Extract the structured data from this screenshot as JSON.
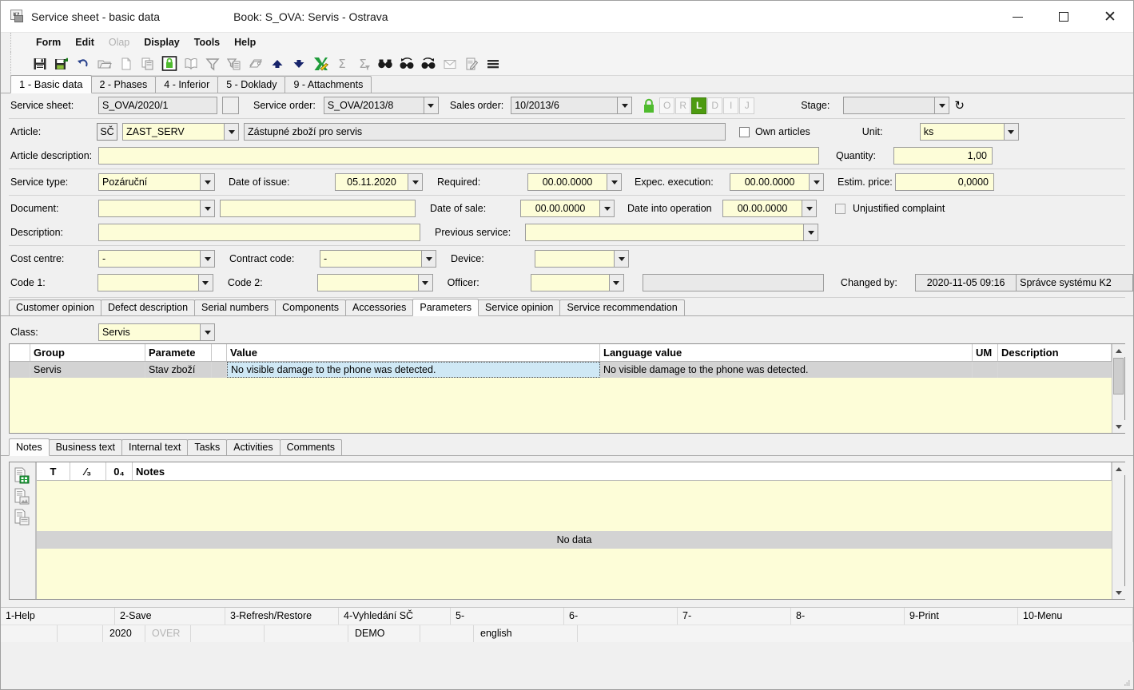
{
  "window": {
    "title": "Service sheet - basic data",
    "book": "Book: S_OVA: Servis - Ostrava",
    "minimize": "—",
    "maximize": "☐",
    "close": "✕"
  },
  "menu": {
    "items": [
      {
        "label": "Form",
        "disabled": false
      },
      {
        "label": "Edit",
        "disabled": false
      },
      {
        "label": "Olap",
        "disabled": true
      },
      {
        "label": "Display",
        "disabled": false
      },
      {
        "label": "Tools",
        "disabled": false
      },
      {
        "label": "Help",
        "disabled": false
      }
    ]
  },
  "toolbar": {
    "buttons": [
      {
        "name": "save-icon"
      },
      {
        "name": "save-and-close-icon"
      },
      {
        "name": "undo-icon"
      },
      {
        "name": "open-folder-icon"
      },
      {
        "name": "new-document-icon"
      },
      {
        "name": "copy-icon"
      },
      {
        "name": "lock-icon"
      },
      {
        "name": "book-icon"
      },
      {
        "name": "filter-icon"
      },
      {
        "name": "filter-document-icon"
      },
      {
        "name": "print-icon"
      },
      {
        "name": "move-up-icon"
      },
      {
        "name": "move-down-icon"
      },
      {
        "name": "export-excel-icon"
      },
      {
        "name": "sum-icon"
      },
      {
        "name": "sum-filter-icon"
      },
      {
        "name": "find-icon"
      },
      {
        "name": "find-previous-icon"
      },
      {
        "name": "find-next-icon"
      },
      {
        "name": "mail-icon"
      },
      {
        "name": "edit-note-icon"
      },
      {
        "name": "menu-icon"
      }
    ]
  },
  "main_tabs": [
    {
      "label": "1 - Basic data",
      "active": true
    },
    {
      "label": "2 - Phases",
      "active": false
    },
    {
      "label": "4 - Inferior",
      "active": false
    },
    {
      "label": "5 - Doklady",
      "active": false
    },
    {
      "label": "9 - Attachments",
      "active": false
    }
  ],
  "form": {
    "service_sheet_label": "Service sheet:",
    "service_sheet_value": "S_OVA/2020/1",
    "service_order_label": "Service order:",
    "service_order_value": "S_OVA/2013/8",
    "sales_order_label": "Sales order:",
    "sales_order_value": "10/2013/6",
    "status_letters": [
      {
        "letter": "O",
        "active": false
      },
      {
        "letter": "R",
        "active": false
      },
      {
        "letter": "L",
        "active": true
      },
      {
        "letter": "D",
        "active": false
      },
      {
        "letter": "I",
        "active": false
      },
      {
        "letter": "J",
        "active": false
      }
    ],
    "stage_label": "Stage:",
    "stage_value": "",
    "article_label": "Article:",
    "article_button": "SČ",
    "article_code": "ZAST_SERV",
    "article_name": "Zástupné zboží pro servis",
    "own_articles_label": "Own articles",
    "own_articles_checked": false,
    "unit_label": "Unit:",
    "unit_value": "ks",
    "article_description_label": "Article description:",
    "article_description_value": "",
    "quantity_label": "Quantity:",
    "quantity_value": "1,00",
    "service_type_label": "Service type:",
    "service_type_value": "Pozáruční",
    "date_of_issue_label": "Date of issue:",
    "date_of_issue_value": "05.11.2020",
    "required_label": "Required:",
    "required_value": "00.00.0000",
    "expec_execution_label": "Expec. execution:",
    "expec_execution_value": "00.00.0000",
    "estim_price_label": "Estim. price:",
    "estim_price_value": "0,0000",
    "document_label": "Document:",
    "document_value": "",
    "document_text_value": "",
    "date_of_sale_label": "Date of sale:",
    "date_of_sale_value": "00.00.0000",
    "date_into_operation_label": "Date into operation",
    "date_into_operation_value": "00.00.0000",
    "unjustified_complaint_label": "Unjustified complaint",
    "unjustified_complaint_checked": false,
    "description_label": "Description:",
    "description_value": "",
    "previous_service_label": "Previous service:",
    "previous_service_value": "",
    "cost_centre_label": "Cost centre:",
    "cost_centre_value": "-",
    "contract_code_label": "Contract code:",
    "contract_code_value": "-",
    "device_label": "Device:",
    "device_value": "",
    "code1_label": "Code 1:",
    "code1_value": "",
    "code2_label": "Code 2:",
    "code2_value": "",
    "officer_label": "Officer:",
    "officer_value": "",
    "officer_text_value": "",
    "changed_by_label": "Changed by:",
    "changed_by_date": "2020-11-05 09:16",
    "changed_by_user": "Správce systému K2"
  },
  "sub_tabs": [
    {
      "label": "Customer opinion",
      "active": false
    },
    {
      "label": "Defect description",
      "active": false
    },
    {
      "label": "Serial numbers",
      "active": false
    },
    {
      "label": "Components",
      "active": false
    },
    {
      "label": "Accessories",
      "active": false
    },
    {
      "label": "Parameters",
      "active": true
    },
    {
      "label": "Service opinion",
      "active": false
    },
    {
      "label": "Service recommendation",
      "active": false
    }
  ],
  "parameters": {
    "class_label": "Class:",
    "class_value": "Servis",
    "columns": [
      "",
      "Group",
      "Paramete",
      "",
      "Value",
      "Language value",
      "UM",
      "Description"
    ],
    "rows": [
      {
        "marker": "",
        "group": "Servis",
        "parameter": "Stav zboží",
        "spacer": "",
        "value": "No visible damage to the phone was detected.",
        "language_value": "No visible damage to the phone was detected.",
        "um": "",
        "description": ""
      }
    ]
  },
  "notes_tabs": [
    {
      "label": "Notes",
      "active": true
    },
    {
      "label": "Business text",
      "active": false
    },
    {
      "label": "Internal text",
      "active": false
    },
    {
      "label": "Tasks",
      "active": false
    },
    {
      "label": "Activities",
      "active": false
    },
    {
      "label": "Comments",
      "active": false
    }
  ],
  "notes": {
    "columns": [
      "T",
      "⁄₃",
      "0₄",
      "Notes"
    ],
    "empty_text": "No data",
    "gutter_icons": [
      "new-note-icon",
      "note-with-image-icon",
      "copy-note-icon"
    ]
  },
  "function_keys": [
    "1-Help",
    "2-Save",
    "3-Refresh/Restore",
    "4-Vyhledání SČ",
    "5-",
    "6-",
    "7-",
    "8-",
    "9-Print",
    "10-Menu"
  ],
  "status_bar": {
    "cells": [
      {
        "text": "",
        "gray": false
      },
      {
        "text": "",
        "gray": false
      },
      {
        "text": "2020",
        "gray": false
      },
      {
        "text": "OVER",
        "gray": true
      },
      {
        "text": "",
        "gray": false
      },
      {
        "text": "",
        "gray": false
      },
      {
        "text": "DEMO",
        "gray": false
      },
      {
        "text": "",
        "gray": false
      },
      {
        "text": "english",
        "gray": false
      },
      {
        "text": "",
        "gray": false
      }
    ]
  },
  "colors": {
    "field_yellow": "#fdfdd8",
    "field_gray": "#e2e2e2",
    "accent_green": "#4d9b10",
    "selection_blue": "#cfe8f5",
    "row_selected": "#d3d3d3"
  }
}
